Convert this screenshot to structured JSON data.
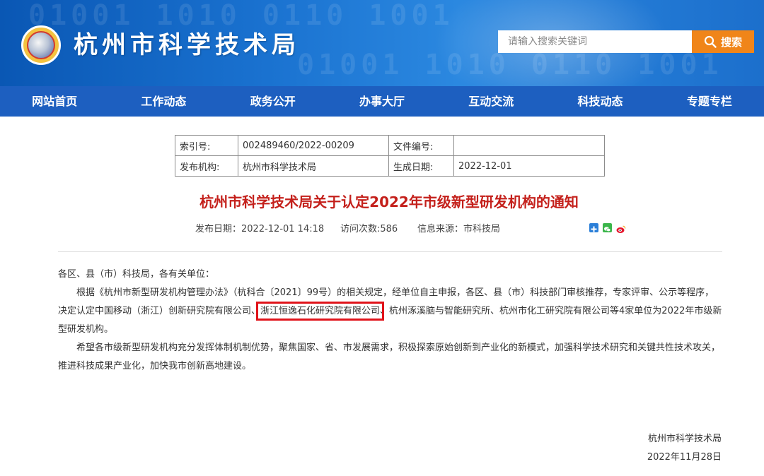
{
  "header": {
    "site_title": "杭州市科学技术局",
    "search": {
      "placeholder": "请输入搜索关键词",
      "button_label": "搜索"
    },
    "deco_text": "01001 1010 0110 1001"
  },
  "nav": {
    "items": [
      {
        "label": "网站首页"
      },
      {
        "label": "工作动态"
      },
      {
        "label": "政务公开"
      },
      {
        "label": "办事大厅"
      },
      {
        "label": "互动交流"
      },
      {
        "label": "科技动态"
      },
      {
        "label": "专题专栏"
      }
    ]
  },
  "meta_table": {
    "index_label": "索引号:",
    "index_value": "002489460/2022-00209",
    "doc_no_label": "文件编号:",
    "doc_no_value": "",
    "publisher_label": "发布机构:",
    "publisher_value": "杭州市科学技术局",
    "date_label": "生成日期:",
    "date_value": "2022-12-01"
  },
  "article": {
    "title": "杭州市科学技术局关于认定2022年市级新型研发机构的通知",
    "publish_date": "发布日期：2022-12-01 14:18",
    "visits": "访问次数:586",
    "source": "信息来源：市科技局",
    "salutation": "各区、县（市）科技局，各有关单位：",
    "para1_part1": "根据《杭州市新型研发机构管理办法》（杭科合〔2021〕99号）的相关规定，经单位自主申报，各区、县（市）科技部门审核推荐，专家评审、公示等程序，决定认定中国移动（浙江）创新研究院有限公司、",
    "para1_highlight": "浙江恒逸石化研究院有限公司",
    "para1_part2": "、杭州涿溪脑与智能研究所、杭州市化工研究院有限公司等4家单位为2022年市级新型研发机构。",
    "para2": "希望各市级新型研发机构充分发挥体制机制优势，聚焦国家、省、市发展需求，积极探索原始创新到产业化的新模式，加强科学技术研究和关键共性技术攻关，推进科技成果产业化，加快我市创新高地建设。",
    "sign_org": "杭州市科学技术局",
    "sign_date": "2022年11月28日"
  },
  "colors": {
    "header_blue": "#1a72d0",
    "nav_blue": "#1d5fc0",
    "search_orange": "#f08519",
    "title_red": "#c4201b",
    "highlight_red": "#e0131a"
  },
  "icons": [
    "emblem-logo-icon",
    "search-icon",
    "share-plus-icon",
    "wechat-icon",
    "weibo-icon"
  ]
}
